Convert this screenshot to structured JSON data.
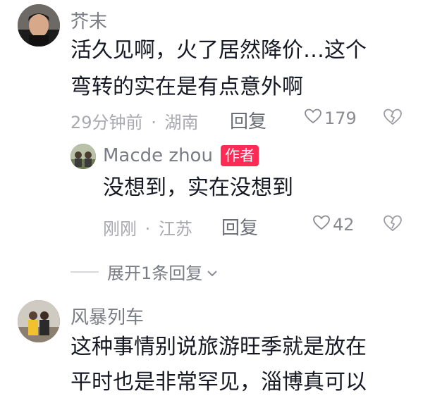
{
  "comments": [
    {
      "username": "芥末",
      "lines": [
        "活久见啊，火了居然降价…这个",
        "弯转的实在是有点意外啊"
      ],
      "time": "29分钟前",
      "location": "湖南",
      "reply_label": "回复",
      "likes": "179"
    },
    {
      "username": "风暴列车",
      "lines": [
        "这种事情别说旅游旺季就是放在",
        "平时也是非常罕见，淄博真可以"
      ]
    }
  ],
  "reply": {
    "username": "Macde zhou",
    "badge": "作者",
    "text": "没想到，实在没想到",
    "time": "刚刚",
    "location": "江苏",
    "reply_label": "回复",
    "likes": "42"
  },
  "expand_label": "展开1条回复",
  "separator": "·",
  "colors": {
    "badge": "#fe2c55",
    "meta": "#a8a9b0",
    "text": "#161823"
  }
}
